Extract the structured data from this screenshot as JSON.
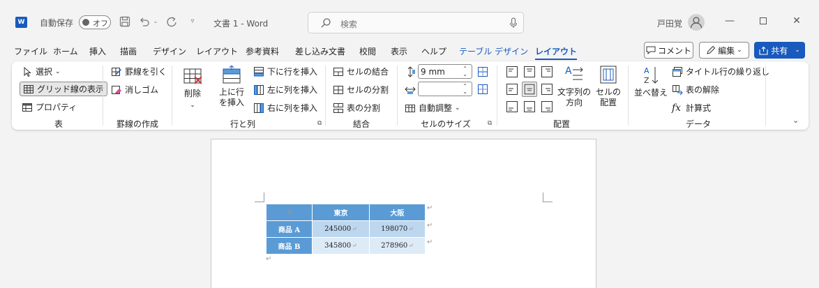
{
  "titlebar": {
    "app_logo": "W",
    "autosave_label": "自動保存",
    "autosave_state": "オフ",
    "doc_title": "文書 1 - Word",
    "search_placeholder": "検索",
    "user_name": "戸田覚"
  },
  "tabs": [
    {
      "label": "ファイル"
    },
    {
      "label": "ホーム"
    },
    {
      "label": "挿入"
    },
    {
      "label": "描画"
    },
    {
      "label": "デザイン"
    },
    {
      "label": "レイアウト"
    },
    {
      "label": "参考資料"
    },
    {
      "label": "差し込み文書"
    },
    {
      "label": "校閲"
    },
    {
      "label": "表示"
    },
    {
      "label": "ヘルプ"
    },
    {
      "label": "テーブル デザイン"
    },
    {
      "label": "レイアウト"
    }
  ],
  "actions": {
    "comment": "コメント",
    "edit": "編集",
    "share": "共有"
  },
  "ribbon": {
    "table_group": {
      "label": "表",
      "select": "選択",
      "gridlines": "グリッド線の表示",
      "properties": "プロパティ"
    },
    "draw_group": {
      "label": "罫線の作成",
      "draw_table": "罫線を引く",
      "eraser": "消しゴム"
    },
    "rows_group": {
      "label": "行と列",
      "delete": "削除",
      "insert_above": "上に行を挿入",
      "insert_below": "下に行を挿入",
      "insert_left": "左に列を挿入",
      "insert_right": "右に列を挿入"
    },
    "merge_group": {
      "label": "結合",
      "merge_cells": "セルの結合",
      "split_cells": "セルの分割",
      "split_table": "表の分割"
    },
    "size_group": {
      "label": "セルのサイズ",
      "height_value": "9 mm",
      "width_value": "",
      "autofit": "自動調整"
    },
    "align_group": {
      "label": "配置",
      "text_direction": "文字列の方向",
      "cell_margins": "セルの配置"
    },
    "data_group": {
      "label": "データ",
      "sort": "並べ替え",
      "repeat_header": "タイトル行の繰り返し",
      "convert_to_text": "表の解除",
      "formula": "計算式"
    }
  },
  "document": {
    "table": {
      "header": [
        "",
        "東京",
        "大阪"
      ],
      "rows": [
        [
          "商品 A",
          "245000",
          "198070"
        ],
        [
          "商品 B",
          "345800",
          "278960"
        ]
      ]
    }
  },
  "colors": {
    "accent": "#185abd",
    "table_header": "#5b9bd5",
    "table_row1": "#bdd7ee",
    "table_row2": "#ddebf7"
  }
}
